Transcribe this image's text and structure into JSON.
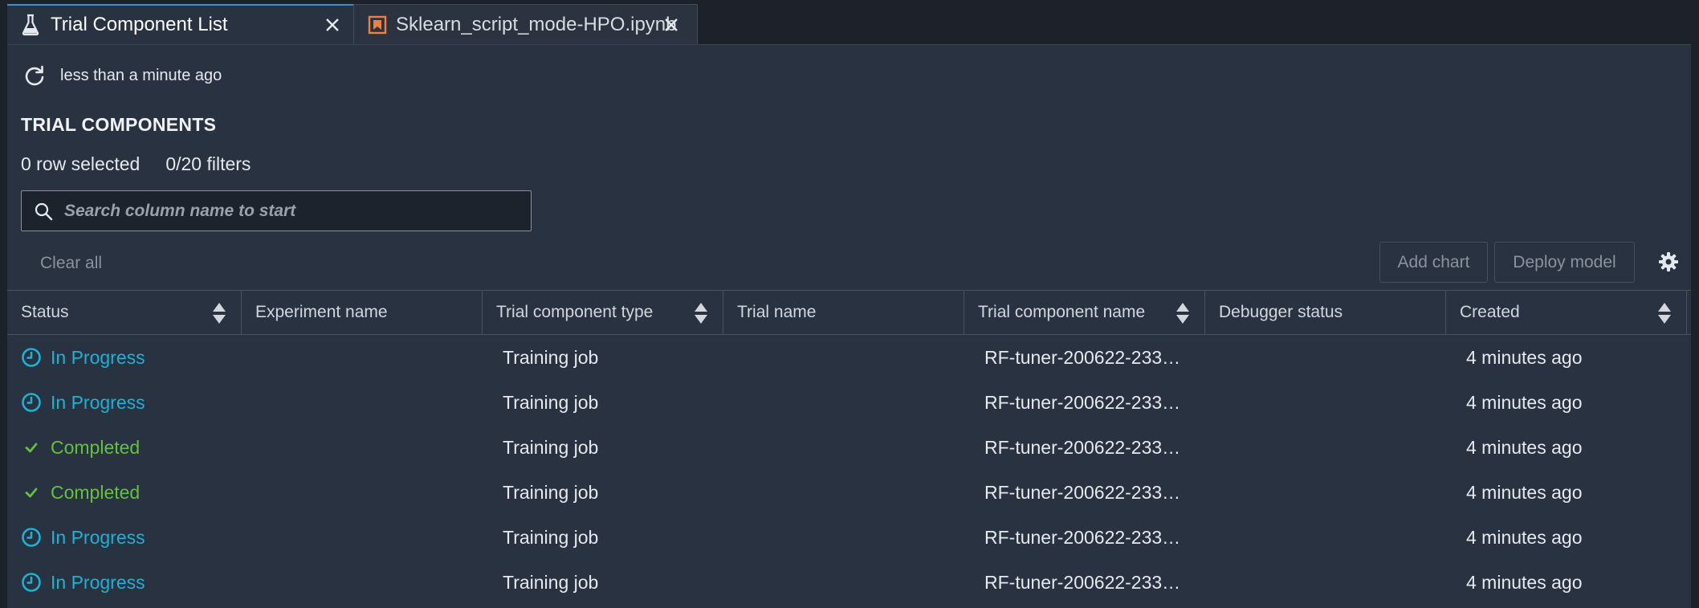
{
  "tabs": [
    {
      "label": "Trial Component List",
      "icon": "flask-icon",
      "active": true
    },
    {
      "label": "Sklearn_script_mode-HPO.ipynb",
      "icon": "notebook-icon",
      "active": false
    }
  ],
  "toolbar": {
    "refresh_label": "less than a minute ago"
  },
  "section": {
    "title": "TRIAL COMPONENTS",
    "rows_selected": "0 row selected",
    "filters": "0/20 filters"
  },
  "search": {
    "placeholder": "Search column name to start",
    "value": ""
  },
  "actions": {
    "clear_all": "Clear all",
    "add_chart": "Add chart",
    "deploy_model": "Deploy model"
  },
  "colors": {
    "accent": "#3e8be0",
    "in_progress": "#1bb2d6",
    "completed": "#63c13d",
    "notebook_icon": "#e8824a"
  },
  "table": {
    "columns": [
      {
        "label": "Status",
        "sortable": true
      },
      {
        "label": "Experiment name",
        "sortable": false
      },
      {
        "label": "Trial component type",
        "sortable": true
      },
      {
        "label": "Trial name",
        "sortable": false
      },
      {
        "label": "Trial component name",
        "sortable": true
      },
      {
        "label": "Debugger status",
        "sortable": false
      },
      {
        "label": "Created",
        "sortable": true
      }
    ],
    "rows": [
      {
        "status": "In Progress",
        "status_icon": "clock-icon",
        "type": "Training job",
        "name": "RF-tuner-200622-233…",
        "created": "4 minutes ago"
      },
      {
        "status": "In Progress",
        "status_icon": "clock-icon",
        "type": "Training job",
        "name": "RF-tuner-200622-233…",
        "created": "4 minutes ago"
      },
      {
        "status": "Completed",
        "status_icon": "check-icon",
        "type": "Training job",
        "name": "RF-tuner-200622-233…",
        "created": "4 minutes ago"
      },
      {
        "status": "Completed",
        "status_icon": "check-icon",
        "type": "Training job",
        "name": "RF-tuner-200622-233…",
        "created": "4 minutes ago"
      },
      {
        "status": "In Progress",
        "status_icon": "clock-icon",
        "type": "Training job",
        "name": "RF-tuner-200622-233…",
        "created": "4 minutes ago"
      },
      {
        "status": "In Progress",
        "status_icon": "clock-icon",
        "type": "Training job",
        "name": "RF-tuner-200622-233…",
        "created": "4 minutes ago"
      }
    ]
  }
}
